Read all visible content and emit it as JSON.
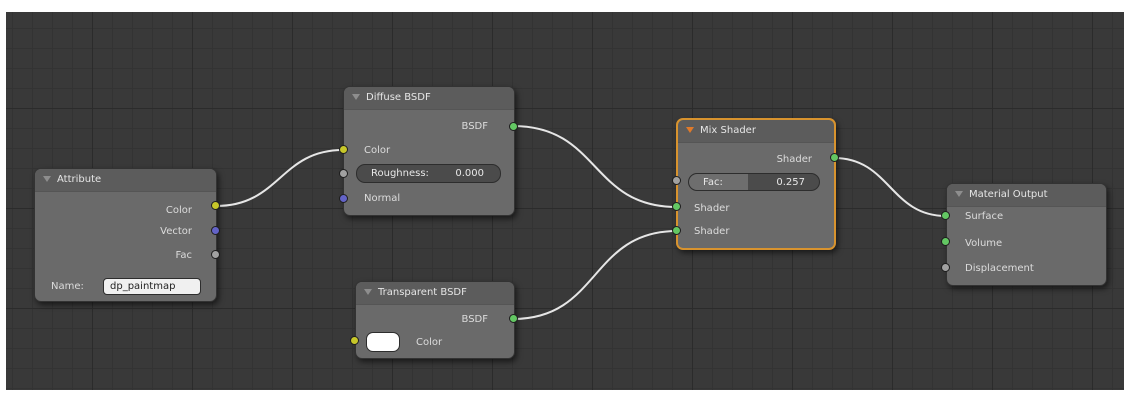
{
  "nodes": {
    "attribute": {
      "title": "Attribute",
      "outputs": [
        "Color",
        "Vector",
        "Fac"
      ],
      "name_label": "Name:",
      "name_value": "dp_paintmap"
    },
    "diffuse": {
      "title": "Diffuse BSDF",
      "output": "BSDF",
      "color_label": "Color",
      "roughness_label": "Roughness:",
      "roughness_value": "0.000",
      "normal_label": "Normal"
    },
    "transparent": {
      "title": "Transparent BSDF",
      "output": "BSDF",
      "color_label": "Color",
      "color_swatch": "#ffffff"
    },
    "mix": {
      "title": "Mix Shader",
      "output": "Shader",
      "fac_label": "Fac:",
      "fac_value": "0.257",
      "fac_fraction": 0.257,
      "input1": "Shader",
      "input2": "Shader"
    },
    "material_output": {
      "title": "Material Output",
      "inputs": [
        "Surface",
        "Volume",
        "Displacement"
      ]
    }
  },
  "colors": {
    "shader_socket": "#63c763",
    "color_socket": "#c7c729",
    "vector_socket": "#6363c7",
    "value_socket": "#a1a1a1",
    "active_border": "#d8932e",
    "wire": "#e6e6e6"
  }
}
